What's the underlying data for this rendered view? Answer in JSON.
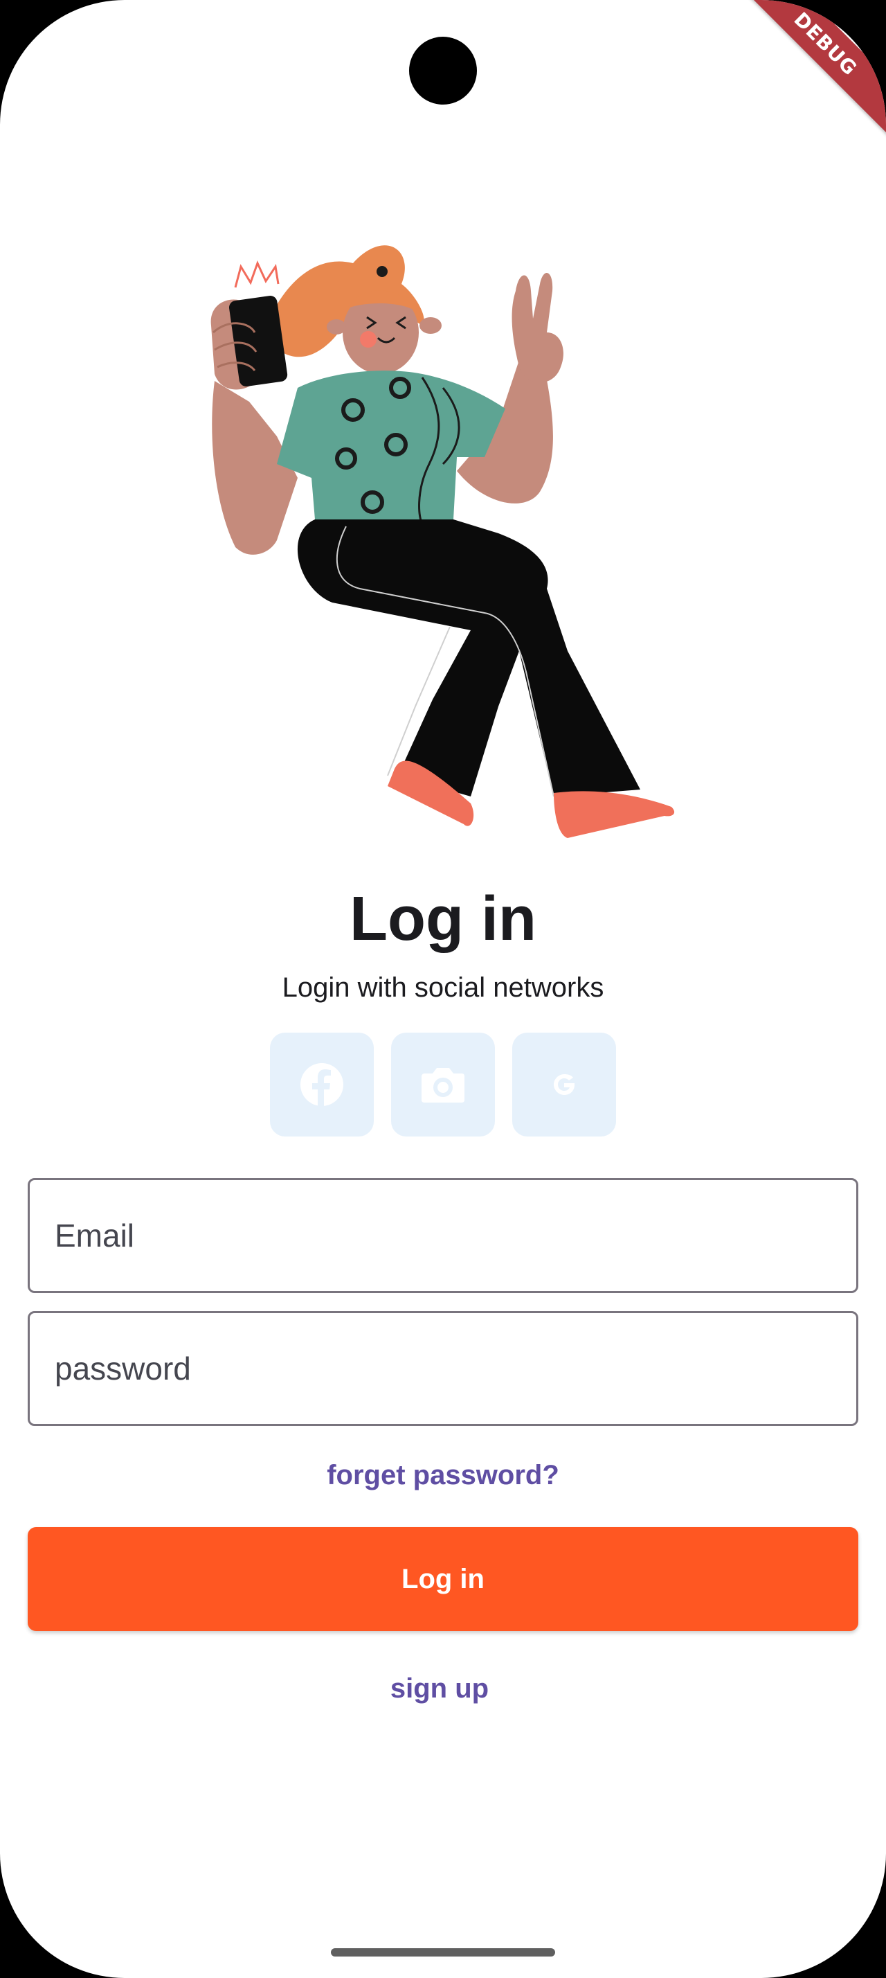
{
  "badge": {
    "debug_label": "DEBUG"
  },
  "login": {
    "title": "Log in",
    "subtitle": "Login with social networks",
    "social_buttons": [
      {
        "icon": "facebook-icon"
      },
      {
        "icon": "camera-icon"
      },
      {
        "icon": "google-icon"
      }
    ],
    "email_placeholder": "Email",
    "password_placeholder": "password",
    "forget_password_label": "forget password?",
    "login_button_label": "Log in",
    "signup_label": "sign up"
  },
  "colors": {
    "primary_button": "#ff5722",
    "link_text": "#5f4ea3",
    "social_tile": "#e6f1fb",
    "field_border": "#79747e"
  }
}
